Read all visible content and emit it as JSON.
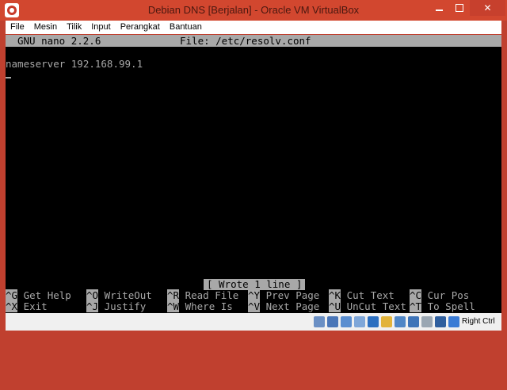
{
  "window": {
    "title": "Debian DNS [Berjalan] - Oracle VM VirtualBox",
    "min_glyph": "",
    "close_glyph": "✕"
  },
  "menu": [
    "File",
    "Mesin",
    "Tilik",
    "Input",
    "Perangkat",
    "Bantuan"
  ],
  "nano": {
    "version": "GNU nano 2.2.6",
    "file_label": "File: /etc/resolv.conf",
    "content_line": "nameserver 192.168.99.1",
    "status_message": "[ Wrote 1 line ]",
    "shortcuts_row1": [
      {
        "key": "^G",
        "label": "Get Help"
      },
      {
        "key": "^O",
        "label": "WriteOut"
      },
      {
        "key": "^R",
        "label": "Read File"
      },
      {
        "key": "^Y",
        "label": "Prev Page"
      },
      {
        "key": "^K",
        "label": "Cut Text"
      },
      {
        "key": "^C",
        "label": "Cur Pos"
      }
    ],
    "shortcuts_row2": [
      {
        "key": "^X",
        "label": "Exit"
      },
      {
        "key": "^J",
        "label": "Justify"
      },
      {
        "key": "^W",
        "label": "Where Is"
      },
      {
        "key": "^V",
        "label": "Next Page"
      },
      {
        "key": "^U",
        "label": "UnCut Text"
      },
      {
        "key": "^T",
        "label": "To Spell"
      }
    ]
  },
  "statusbar": {
    "icons": [
      "hard-disk-icon",
      "optical-drive-icon",
      "usb-icon",
      "floppy-icon",
      "network-icon",
      "shared-folders-icon",
      "display-icon",
      "recording-icon",
      "cpu-icon",
      "mouse-integration-icon",
      "arrow-icon"
    ],
    "icon_colors": [
      "#6a8fc4",
      "#4a76b8",
      "#5a8ed0",
      "#7fa7d9",
      "#2c6fc0",
      "#e2b33a",
      "#4f86c6",
      "#3e74b8",
      "#9aa6b2",
      "#2f5f9e",
      "#3a7bd5"
    ],
    "host_key": "Right Ctrl"
  }
}
